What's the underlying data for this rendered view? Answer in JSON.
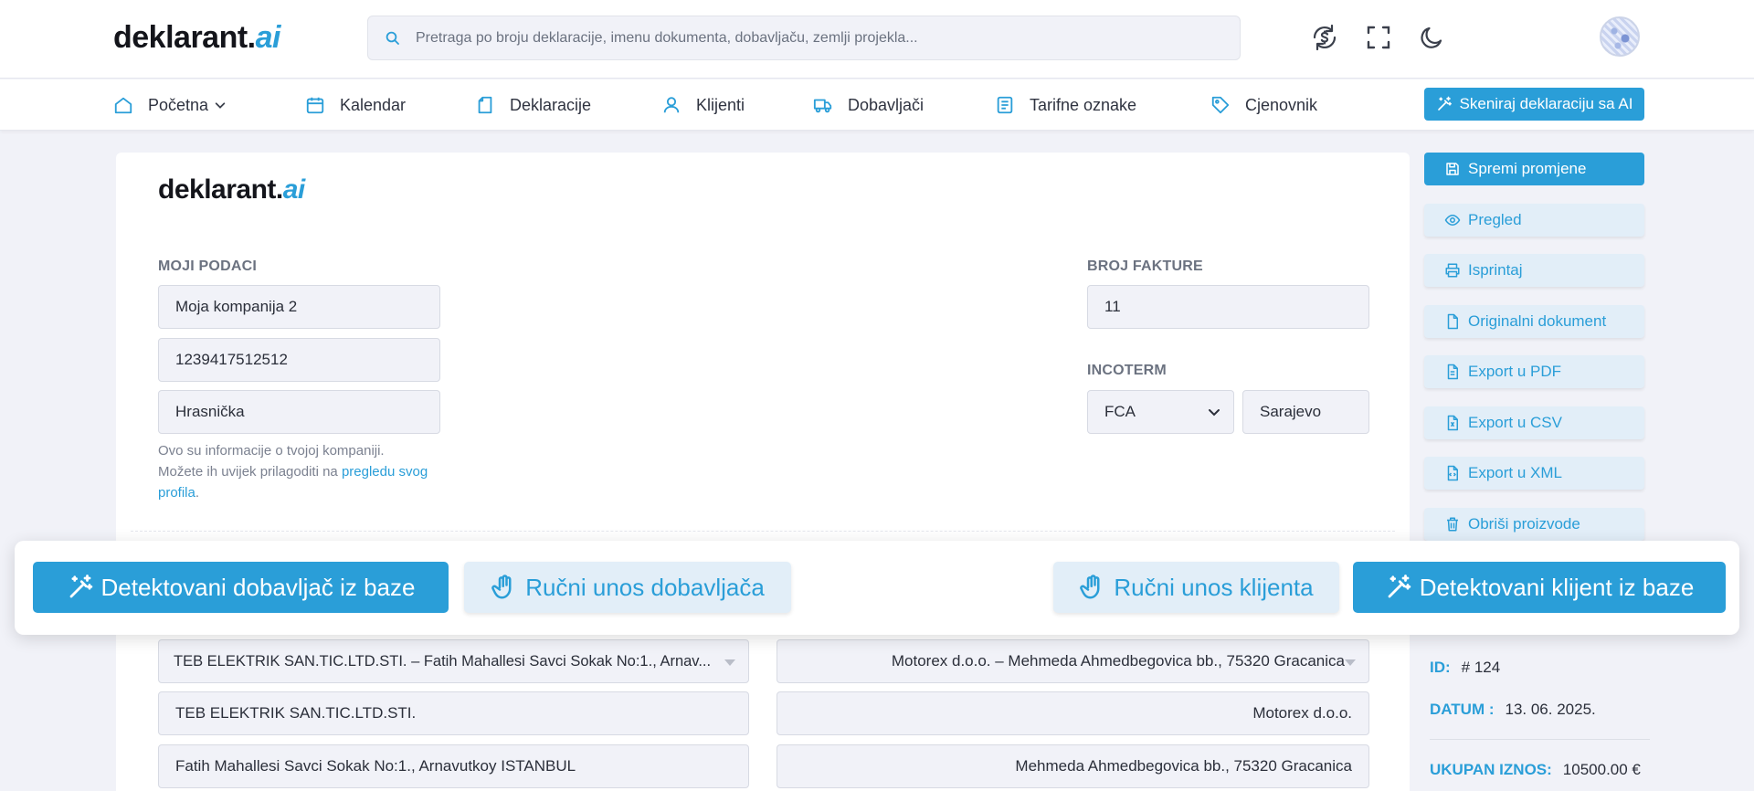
{
  "header": {
    "logo_main": "deklarant.",
    "logo_ai": "ai",
    "search_placeholder": "Pretraga po broju deklaracije, imenu dokumenta, dobavljaču, zemlji projekla...",
    "icons": [
      "currency-exchange-icon",
      "fullscreen-icon",
      "moon-icon"
    ]
  },
  "nav": {
    "items": [
      {
        "label": "Početna",
        "icon": "home-icon"
      },
      {
        "label": "Kalendar",
        "icon": "calendar-icon"
      },
      {
        "label": "Deklaracije",
        "icon": "document-icon"
      },
      {
        "label": "Klijenti",
        "icon": "user-icon"
      },
      {
        "label": "Dobavljači",
        "icon": "truck-icon"
      },
      {
        "label": "Tarifne oznake",
        "icon": "list-icon"
      },
      {
        "label": "Cjenovnik",
        "icon": "tag-icon"
      }
    ],
    "scan_button": "Skeniraj deklaraciju sa AI"
  },
  "invoice": {
    "logo_main": "deklarant.",
    "logo_ai": "ai",
    "my_data_label": "MOJI PODACI",
    "company_name": "Moja kompanija 2",
    "company_id": "1239417512512",
    "company_address": "Hrasnička",
    "help_text": "Ovo su informacije o tvojoj kompaniji. Možete ih uvijek prilagoditi na ",
    "help_link": "pregledu svog profila",
    "help_end": ".",
    "invoice_number_label": "BROJ FAKTURE",
    "invoice_number": "11",
    "incoterm_label": "INCOTERM",
    "incoterm_value": "FCA",
    "incoterm_place": "Sarajevo",
    "supplier_select": "TEB ELEKTRIK SAN.TIC.LTD.STI. – Fatih Mahallesi Savci Sokak No:1., Arnav...",
    "supplier_name": "TEB ELEKTRIK SAN.TIC.LTD.STI.",
    "supplier_address": "Fatih Mahallesi Savci Sokak No:1., Arnavutkoy ISTANBUL",
    "client_select": "Motorex d.o.o. – Mehmeda Ahmedbegovica bb., 75320 Gracanica",
    "client_name": "Motorex d.o.o.",
    "client_address": "Mehmeda Ahmedbegovica bb., 75320 Gracanica"
  },
  "sidebar": {
    "buttons": [
      {
        "label": "Spremi promjene",
        "icon": "save-icon"
      },
      {
        "label": "Pregled",
        "icon": "eye-icon"
      },
      {
        "label": "Isprintaj",
        "icon": "printer-icon"
      },
      {
        "label": "Originalni dokument",
        "icon": "file-icon"
      },
      {
        "label": "Export u PDF",
        "icon": "pdf-icon"
      },
      {
        "label": "Export u CSV",
        "icon": "csv-icon"
      },
      {
        "label": "Export u XML",
        "icon": "xml-icon"
      },
      {
        "label": "Obriši proizvode",
        "icon": "trash-icon"
      }
    ],
    "id_label": "ID:",
    "id_value": "# 124",
    "date_label": "DATUM :",
    "date_value": "13. 06. 2025.",
    "total_label": "UKUPAN IZNOS:",
    "total_value": "10500.00 €"
  },
  "overlay": {
    "detected_supplier": "Detektovani dobavljač iz baze",
    "manual_supplier": "Ručni unos dobavljača",
    "manual_client": "Ručni unos klijenta",
    "detected_client": "Detektovani klijent iz baze"
  },
  "colors": {
    "accent": "#2a9ed8",
    "accent_soft": "#e2eef8",
    "page_bg": "#f1f2f8"
  }
}
